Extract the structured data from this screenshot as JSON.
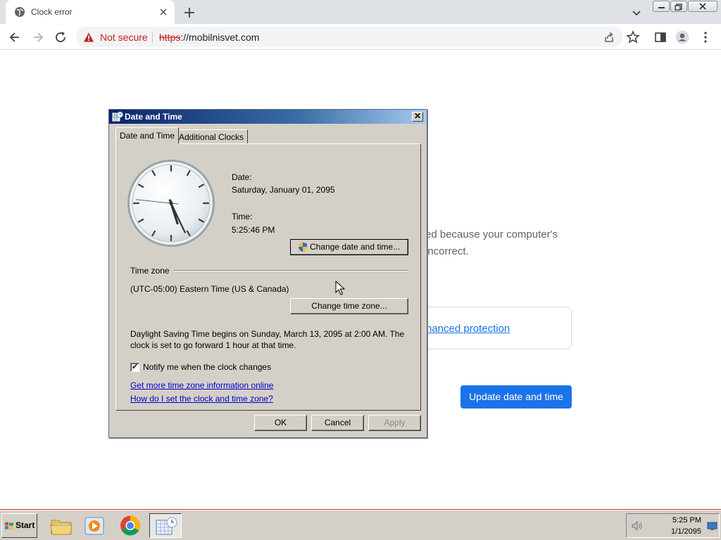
{
  "browser": {
    "tab": {
      "title": "Clock error"
    },
    "omnibox": {
      "security_label": "Not secure",
      "url_scheme": "https",
      "url_rest": "://mobilnisvet.com"
    }
  },
  "page": {
    "partial_text_line1": "ed because your computer's",
    "partial_text_line2": "incorrect.",
    "partial_link": "hanced protection",
    "update_button": "Update date and time"
  },
  "dialog": {
    "title": "Date and Time",
    "close_glyph": "✕",
    "tabs": [
      "Date and Time",
      "Additional Clocks"
    ],
    "date_label": "Date:",
    "date_value": "Saturday, January 01, 2095",
    "time_label": "Time:",
    "time_value": "5:25:46 PM",
    "change_datetime_button": "Change date and time...",
    "timezone_label": "Time zone",
    "timezone_value": "(UTC-05:00) Eastern Time (US & Canada)",
    "change_timezone_button": "Change time zone...",
    "dst_text": "Daylight Saving Time begins on Sunday, March 13, 2095 at 2:00 AM. The clock is set to go forward 1 hour at that time.",
    "notify_checkbox": {
      "label": "Notify me when the clock changes",
      "checked": true
    },
    "link_more_info": "Get more time zone information online",
    "link_how_set": "How do I set the clock and time zone?",
    "ok_button": "OK",
    "cancel_button": "Cancel",
    "apply_button": "Apply",
    "clock": {
      "hour": 5,
      "minute": 25,
      "second": 46
    }
  },
  "taskbar": {
    "start_label": "Start",
    "apps": [
      "folder-icon",
      "media-player-icon",
      "chrome-icon",
      "date-time-icon"
    ],
    "tray_time": "5:25 PM",
    "tray_date": "1/1/2095"
  },
  "colors": {
    "accent_blue": "#1a73e8",
    "not_secure_red": "#c5221f",
    "dialog_face": "#d4d0c8",
    "title_bar": "#0a246a"
  }
}
